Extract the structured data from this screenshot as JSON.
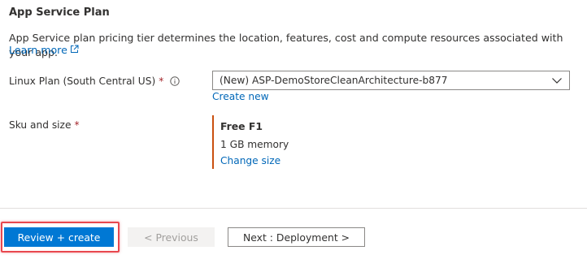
{
  "section": {
    "title": "App Service Plan",
    "description": "App Service plan pricing tier determines the location, features, cost and compute resources associated with your app.",
    "learn_more": "Learn more"
  },
  "linux_plan": {
    "label": "Linux Plan (South Central US)",
    "required_mark": "*",
    "selected_value": "(New) ASP-DemoStoreCleanArchitecture-b877",
    "create_new": "Create new"
  },
  "sku": {
    "label": "Sku and size",
    "required_mark": "*",
    "name": "Free F1",
    "memory": "1 GB memory",
    "change_size": "Change size"
  },
  "footer": {
    "review_create": "Review + create",
    "previous": "< Previous",
    "next": "Next : Deployment >"
  },
  "icons": {
    "external_link": "external-link-icon",
    "info": "info-icon",
    "chevron_down": "chevron-down-icon"
  },
  "colors": {
    "accent": "#0078d4",
    "link": "#0067b8",
    "required": "#a4262c",
    "sku_border": "#ca5010",
    "highlight": "#e8484f"
  }
}
